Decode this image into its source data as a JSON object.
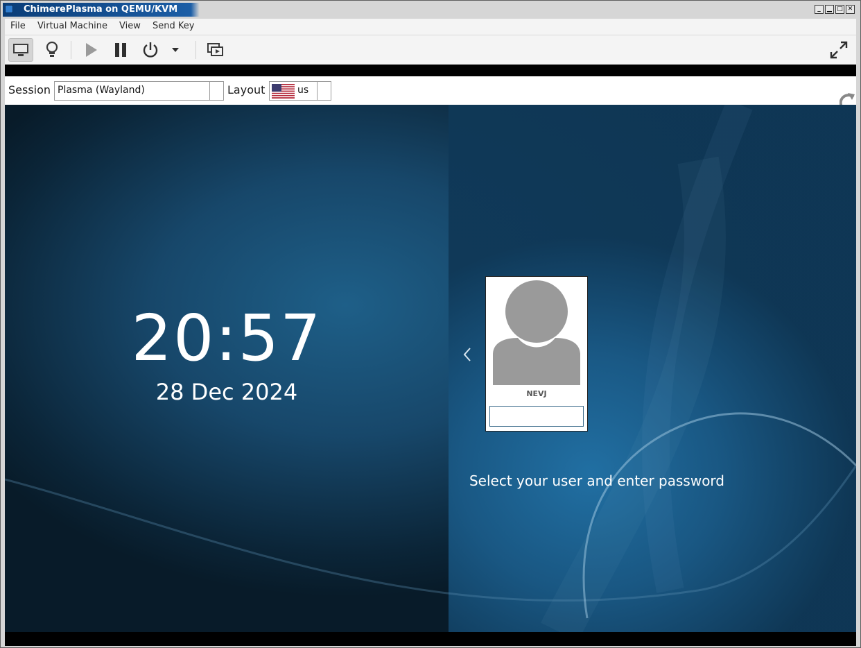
{
  "window": {
    "title": "ChimerePlasma on QEMU/KVM",
    "controls": [
      "minimize",
      "maximize",
      "restore",
      "close"
    ]
  },
  "menubar": {
    "items": [
      "File",
      "Virtual Machine",
      "View",
      "Send Key"
    ]
  },
  "toolbar": {
    "icons": [
      "console-icon",
      "details-lightbulb-icon",
      "run-play-icon",
      "pause-icon",
      "power-icon",
      "dropdown-arrow-icon",
      "snapshots-icon",
      "fullscreen-icon"
    ]
  },
  "guest": {
    "session_label": "Session",
    "session_value": "Plasma (Wayland)",
    "layout_label": "Layout",
    "layout_value": "us",
    "clock": "20:57",
    "date": "28 Dec 2024",
    "user": {
      "name": "NEVJ",
      "password": ""
    },
    "hint": "Select your user and enter password"
  },
  "colors": {
    "titlebar": "#0a3d78",
    "wallpaper": "#17476a",
    "accent": "#2273a8"
  }
}
